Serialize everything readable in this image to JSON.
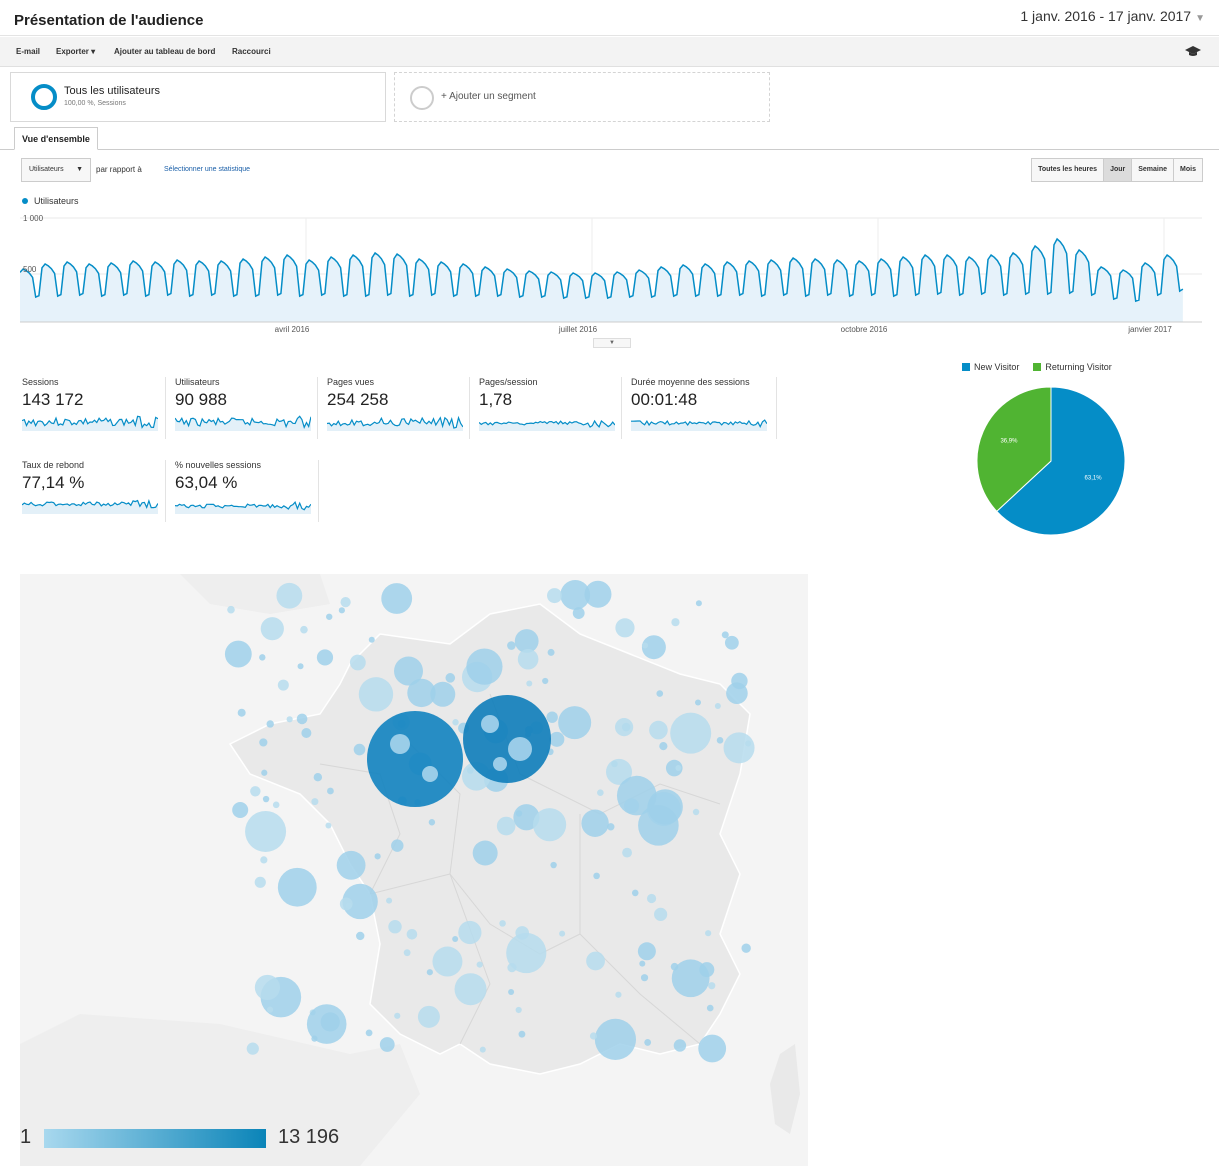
{
  "header": {
    "title": "Présentation de l'audience",
    "date_range": "1 janv. 2016 - 17 janv. 2017"
  },
  "toolbar": {
    "email": "E-mail",
    "export": "Exporter",
    "add_dashboard": "Ajouter au tableau de bord",
    "shortcut": "Raccourci",
    "icon": "graduation-cap-icon"
  },
  "segments": {
    "active": {
      "title": "Tous les utilisateurs",
      "subtitle": "100,00 %, Sessions"
    },
    "add_label": "+ Ajouter un segment"
  },
  "tabs": {
    "overview": "Vue d'ensemble"
  },
  "controls": {
    "metric": "Utilisateurs",
    "compare_label": "par rapport à",
    "compare_link": "Sélectionner une statistique",
    "periods": [
      "Toutes les heures",
      "Jour",
      "Semaine",
      "Mois"
    ],
    "active_period": "Jour"
  },
  "chart_data": {
    "type": "area",
    "series": [
      {
        "name": "Utilisateurs",
        "color": "#058dc7",
        "weekly_weekday_peaks": [
          420,
          470,
          490,
          470,
          480,
          500,
          490,
          510,
          500,
          500,
          520,
          540,
          560,
          510,
          540,
          560,
          580,
          570,
          520,
          490,
          470,
          440,
          420,
          400,
          390,
          380,
          380,
          390,
          410,
          440,
          460,
          470,
          490,
          500,
          510,
          530,
          520,
          510,
          500,
          520,
          540,
          560,
          560,
          540,
          560,
          580,
          650,
          720,
          610,
          440,
          410,
          480,
          560
        ],
        "weekly_weekend_lows": [
          140,
          150,
          160,
          150,
          160,
          150,
          160,
          150,
          160,
          150,
          150,
          160,
          150,
          160,
          150,
          150,
          160,
          150,
          160,
          150,
          150,
          150,
          140,
          140,
          130,
          130,
          130,
          140,
          140,
          150,
          150,
          150,
          160,
          150,
          160,
          150,
          160,
          150,
          160,
          150,
          160,
          170,
          160,
          170,
          160,
          170,
          170,
          180,
          160,
          120,
          100,
          160,
          200
        ]
      }
    ],
    "ylim": [
      0,
      1000
    ],
    "y_ticks": [
      "1 000",
      "500"
    ],
    "x_ticks": [
      "avril 2016",
      "juillet 2016",
      "octobre 2016",
      "janvier 2017"
    ],
    "x_tick_weeks": [
      13,
      26,
      39,
      52
    ],
    "grid": true
  },
  "scorecards": [
    {
      "label": "Sessions",
      "value": "143 172"
    },
    {
      "label": "Utilisateurs",
      "value": "90 988"
    },
    {
      "label": "Pages vues",
      "value": "254 258"
    },
    {
      "label": "Pages/session",
      "value": "1,78"
    },
    {
      "label": "Durée moyenne des sessions",
      "value": "00:01:48"
    },
    {
      "label": "Taux de rebond",
      "value": "77,14 %"
    },
    {
      "label": "% nouvelles sessions",
      "value": "63,04 %"
    }
  ],
  "pie": {
    "legend": [
      "New Visitor",
      "Returning Visitor"
    ],
    "values": [
      63.1,
      36.9
    ],
    "labels": [
      "63,1%",
      "36,9%"
    ],
    "colors": [
      "#058dc7",
      "#50b432"
    ]
  },
  "map": {
    "legend_min": "1",
    "legend_max": "13 196",
    "low_color": "#a8d8ee",
    "high_color": "#0a84b8"
  }
}
